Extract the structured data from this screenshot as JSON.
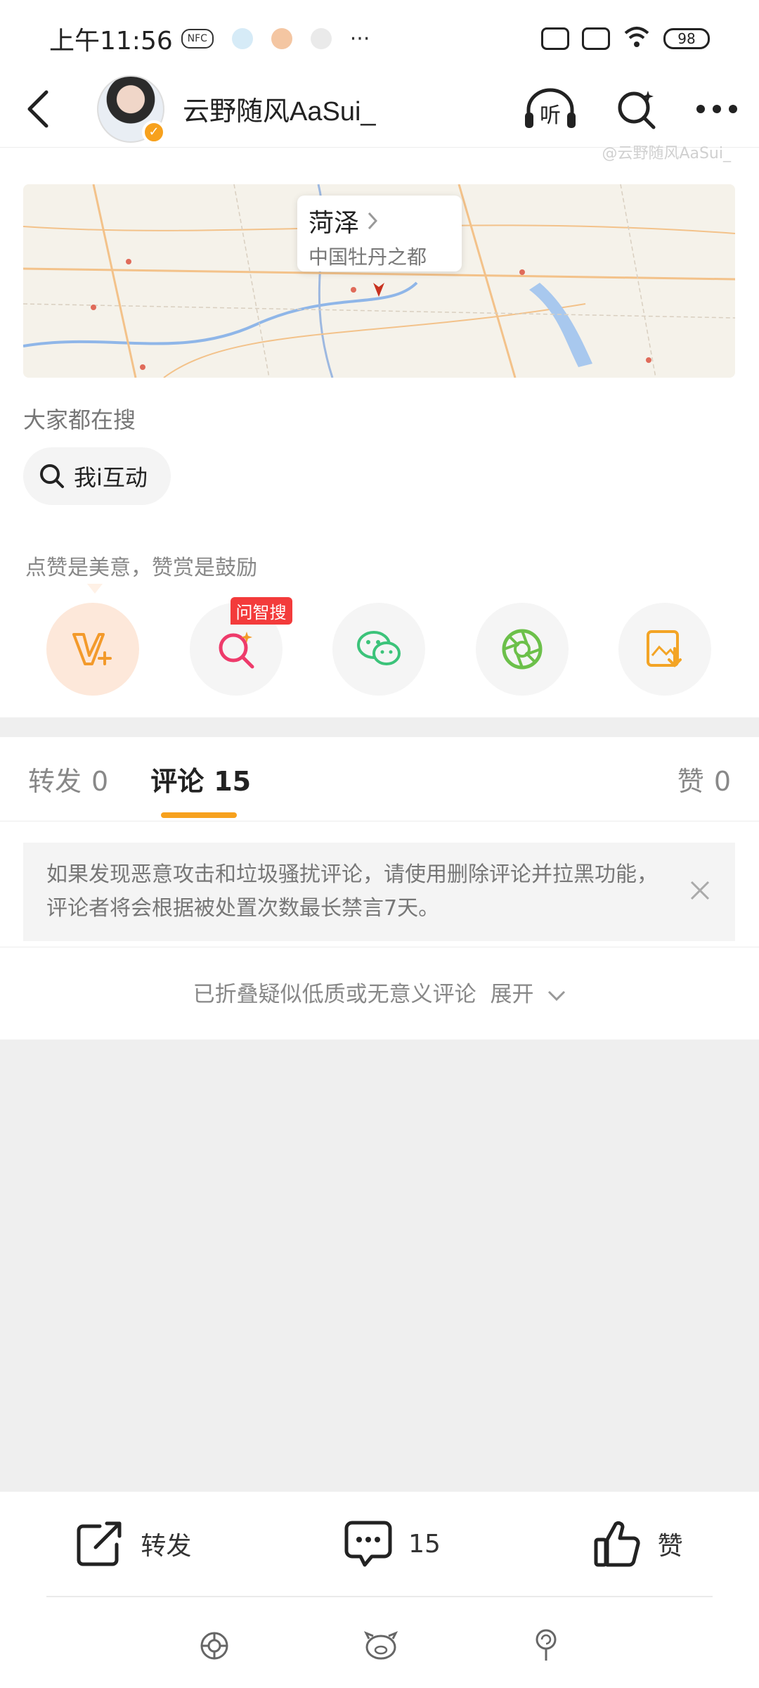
{
  "status_bar": {
    "time": "上午11:56",
    "nfc": "NFC",
    "more": "···",
    "battery": "98"
  },
  "header": {
    "username": "云野随风AaSui_",
    "listen_label": "听"
  },
  "watermark": "@云野随风AaSui_",
  "map": {
    "city": "菏泽",
    "subtitle": "中国牡丹之都"
  },
  "search": {
    "section_label": "大家都在搜",
    "chip_text": "我i互动"
  },
  "reward": {
    "text": "点赞是美意，赞赏是鼓励",
    "badge": "问智搜"
  },
  "tabs": {
    "repost_label": "转发",
    "repost_count": "0",
    "comment_label": "评论",
    "comment_count": "15",
    "like_label": "赞",
    "like_count": "0"
  },
  "notice": {
    "text": "如果发现恶意攻击和垃圾骚扰评论，请使用删除评论并拉黑功能，评论者将会根据被处置次数最长禁言7天。"
  },
  "folded": {
    "text": "已折叠疑似低质或无意义评论",
    "expand": "展开"
  },
  "bottom_bar": {
    "repost": "转发",
    "comments": "15",
    "like": "赞"
  },
  "colors": {
    "accent": "#f7a11d",
    "badge_red": "#f33b3b",
    "wechat_green": "#3cc37a",
    "moments_green": "#6cc04a",
    "gray_bg": "#efefef"
  }
}
